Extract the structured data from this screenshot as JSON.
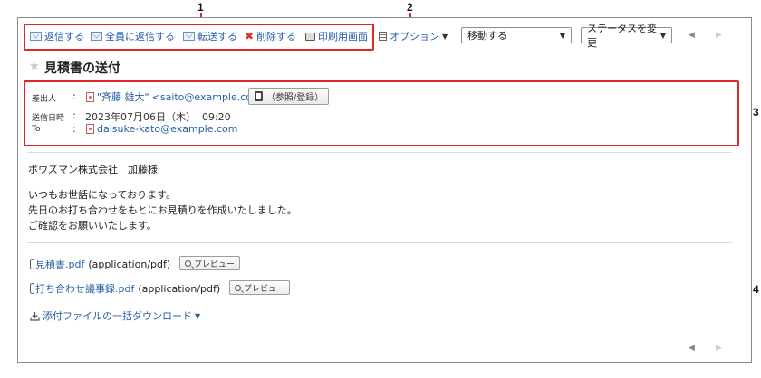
{
  "callouts": [
    "1",
    "2",
    "3",
    "4"
  ],
  "toolbar": {
    "reply": "返信する",
    "reply_all": "全員に返信する",
    "forward": "転送する",
    "delete": "削除する",
    "print": "印刷用画面",
    "options": "オプション",
    "move_select": "移動する",
    "status_select": "ステータスを変更"
  },
  "mail": {
    "subject": "見積書の送付",
    "sender_label": "差出人",
    "sender_name": "\"斉藤 雄大\"",
    "sender_email": "<saito@example.com>",
    "ref_button": "（参照/登録）",
    "date_label": "送信日時",
    "date_value": "2023年07月06日（木）  09:20",
    "to_label": "To",
    "to_value": "daisuke-kato@example.com",
    "colon": ":",
    "body": {
      "greeting": "ボウズマン株式会社　加藤様",
      "line1": "いつもお世話になっております。",
      "line2": "先日のお打ち合わせをもとにお見積りを作成いたしました。",
      "line3": "ご確認をお願いいたします。"
    }
  },
  "attachments": [
    {
      "name": "見積書.pdf",
      "type": "(application/pdf)",
      "preview": "プレビュー"
    },
    {
      "name": "打ち合わせ議事録.pdf",
      "type": "(application/pdf)",
      "preview": "プレビュー"
    }
  ],
  "download_all": "添付ファイルの一括ダウンロード",
  "pager": {
    "prev": "◀",
    "next": "▶"
  },
  "colors": {
    "callout_red": "#e0252b",
    "link_blue": "#2660a8"
  }
}
